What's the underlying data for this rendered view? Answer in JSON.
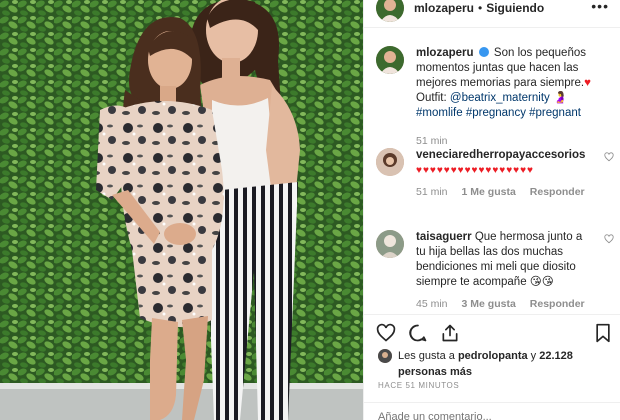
{
  "header": {
    "username": "mlozaperu",
    "separator": "•",
    "follow_status": "Siguiendo",
    "more_icon": "more-options-icon"
  },
  "caption": {
    "username": "mlozaperu",
    "text": "Son los pequeños momentos juntas que hacen las mejores memorias para siempre.",
    "heart_emoji": "♥",
    "outfit_label": "Outfit:",
    "outfit_handle": "@beatrix_maternity",
    "pregnant_emoji": "🤰",
    "hashtags": "#momlife #pregnancy #pregnant",
    "time": "51 min"
  },
  "comments": [
    {
      "username": "veneciaredherropayaccesorios",
      "text": "♥♥♥♥♥♥♥♥♥♥♥♥♥♥♥♥♥",
      "time": "51 min",
      "likes": "1 Me gusta",
      "reply": "Responder"
    },
    {
      "username": "taisaguerr",
      "text": "Que hermosa junto a tu hija bellas las dos muchas bendiciones mi meli que diosito siempre te acompañe",
      "emojis": "😘😘",
      "time": "45 min",
      "likes": "3 Me gusta",
      "reply": "Responder"
    }
  ],
  "likes": {
    "prefix": "Les gusta a",
    "user": "pedrolopanta",
    "connector": "y",
    "count": "22.128 personas más"
  },
  "time_ago": "HACE 51 MINUTOS",
  "add_comment_placeholder": "Añade un comentario...",
  "icons": [
    "heart-icon",
    "comment-icon",
    "share-icon",
    "bookmark-icon"
  ],
  "colors": {
    "link": "#00376b",
    "muted": "#8e8e8e",
    "heart_red": "#ed1c24"
  }
}
